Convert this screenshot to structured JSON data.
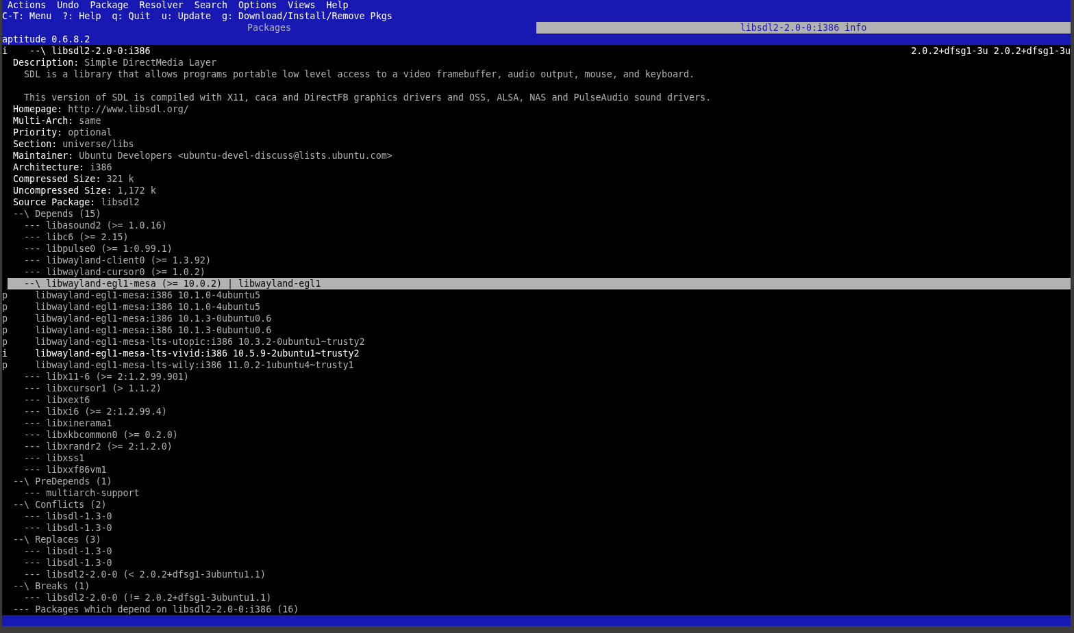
{
  "menu_bar": {
    "items": [
      "Actions",
      "Undo",
      "Package",
      "Resolver",
      "Search",
      "Options",
      "Views",
      "Help"
    ]
  },
  "shortcut_bar": {
    "items": [
      "C-T: Menu",
      "?: Help",
      "q: Quit",
      "u: Update",
      "g: Download/Install/Remove Pkgs"
    ]
  },
  "tabs": [
    {
      "label": "Packages",
      "selected": false
    },
    {
      "label": "libsdl2-2.0-0:i386 info",
      "selected": true
    }
  ],
  "title": "aptitude 0.6.8.2",
  "package": {
    "flag": "i",
    "label": "--\\ libsdl2-2.0-0:i386",
    "versions": [
      "2.0.2+dfsg1-3u",
      "2.0.2+dfsg1-3u"
    ],
    "fields": [
      {
        "label": "Description:",
        "value": "Simple DirectMedia Layer",
        "paragraphs": [
          "SDL is a library that allows programs portable low level access to a video framebuffer, audio output, mouse, and keyboard.",
          "This version of SDL is compiled with X11, caca and DirectFB graphics drivers and OSS, ALSA, NAS and PulseAudio sound drivers."
        ]
      },
      {
        "label": "Homepage:",
        "value": "http://www.libsdl.org/"
      },
      {
        "label": "Multi-Arch:",
        "value": "same"
      },
      {
        "label": "Priority:",
        "value": "optional"
      },
      {
        "label": "Section:",
        "value": "universe/libs"
      },
      {
        "label": "Maintainer:",
        "value": "Ubuntu Developers <ubuntu-devel-discuss@lists.ubuntu.com>"
      },
      {
        "label": "Architecture:",
        "value": "i386"
      },
      {
        "label": "Compressed Size:",
        "value": "321 k"
      },
      {
        "label": "Uncompressed Size:",
        "value": "1,172 k"
      },
      {
        "label": "Source Package:",
        "value": "libsdl2"
      }
    ],
    "tree": [
      {
        "label": "--\\ Depends (15)",
        "selected": false,
        "children": [
          {
            "label": "--- libasound2 (>= 1.0.16)",
            "selected": false
          },
          {
            "label": "--- libc6 (>= 2.15)",
            "selected": false
          },
          {
            "label": "--- libpulse0 (>= 1:0.99.1)",
            "selected": false
          },
          {
            "label": "--- libwayland-client0 (>= 1.3.92)",
            "selected": false
          },
          {
            "label": "--- libwayland-cursor0 (>= 1.0.2)",
            "selected": false
          },
          {
            "label": "--\\ libwayland-egl1-mesa (>= 10.0.2) | libwayland-egl1",
            "selected": true,
            "children": [
              {
                "flag": "p",
                "label": "libwayland-egl1-mesa:i386 10.1.0-4ubuntu5",
                "installed": false,
                "selected": false
              },
              {
                "flag": "p",
                "label": "libwayland-egl1-mesa:i386 10.1.0-4ubuntu5",
                "installed": false,
                "selected": false
              },
              {
                "flag": "p",
                "label": "libwayland-egl1-mesa:i386 10.1.3-0ubuntu0.6",
                "installed": false,
                "selected": false
              },
              {
                "flag": "p",
                "label": "libwayland-egl1-mesa:i386 10.1.3-0ubuntu0.6",
                "installed": false,
                "selected": false
              },
              {
                "flag": "p",
                "label": "libwayland-egl1-mesa-lts-utopic:i386 10.3.2-0ubuntu1~trusty2",
                "installed": false,
                "selected": false
              },
              {
                "flag": "i",
                "label": "libwayland-egl1-mesa-lts-vivid:i386 10.5.9-2ubuntu1~trusty2",
                "installed": true,
                "selected": false
              },
              {
                "flag": "p",
                "label": "libwayland-egl1-mesa-lts-wily:i386 11.0.2-1ubuntu4~trusty1",
                "installed": false,
                "selected": false
              }
            ]
          },
          {
            "label": "--- libx11-6 (>= 2:1.2.99.901)",
            "selected": false
          },
          {
            "label": "--- libxcursor1 (> 1.1.2)",
            "selected": false
          },
          {
            "label": "--- libxext6",
            "selected": false
          },
          {
            "label": "--- libxi6 (>= 2:1.2.99.4)",
            "selected": false
          },
          {
            "label": "--- libxinerama1",
            "selected": false
          },
          {
            "label": "--- libxkbcommon0 (>= 0.2.0)",
            "selected": false
          },
          {
            "label": "--- libxrandr2 (>= 2:1.2.0)",
            "selected": false
          },
          {
            "label": "--- libxss1",
            "selected": false
          },
          {
            "label": "--- libxxf86vm1",
            "selected": false
          }
        ]
      },
      {
        "label": "--\\ PreDepends (1)",
        "selected": false,
        "children": [
          {
            "label": "--- multiarch-support",
            "selected": false
          }
        ]
      },
      {
        "label": "--\\ Conflicts (2)",
        "selected": false,
        "children": [
          {
            "label": "--- libsdl-1.3-0",
            "selected": false
          },
          {
            "label": "--- libsdl-1.3-0",
            "selected": false
          }
        ]
      },
      {
        "label": "--\\ Replaces (3)",
        "selected": false,
        "children": [
          {
            "label": "--- libsdl-1.3-0",
            "selected": false
          },
          {
            "label": "--- libsdl-1.3-0",
            "selected": false
          },
          {
            "label": "--- libsdl2-2.0-0 (< 2.0.2+dfsg1-3ubuntu1.1)",
            "selected": false
          }
        ]
      },
      {
        "label": "--\\ Breaks (1)",
        "selected": false,
        "children": [
          {
            "label": "--- libsdl2-2.0-0 (!= 2.0.2+dfsg1-3ubuntu1.1)",
            "selected": false
          }
        ]
      },
      {
        "label": "--- Packages which depend on libsdl2-2.0-0:i386 (16)",
        "selected": false
      }
    ]
  }
}
